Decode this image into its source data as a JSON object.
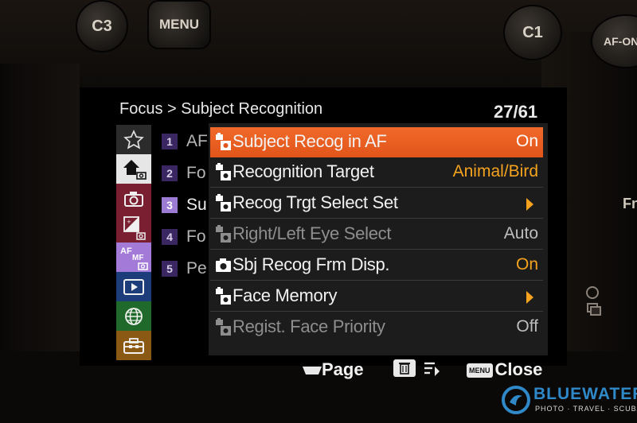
{
  "camera": {
    "buttons": {
      "c3": "C3",
      "menu": "MENU",
      "c1": "C1",
      "af_on": "AF-ON",
      "side_f": "Fn"
    }
  },
  "header": {
    "breadcrumb": "Focus > Subject Recognition",
    "page_counter": "27/61"
  },
  "tabs": [
    {
      "icon": "star-icon",
      "label": "My Menu"
    },
    {
      "icon": "home-camera-icon",
      "label": "Main"
    },
    {
      "icon": "camera-icon",
      "label": "Shooting"
    },
    {
      "icon": "exposure-icon",
      "label": "Exposure/Color"
    },
    {
      "icon": "af-mf-icon",
      "label": "Focus",
      "text": "AF MF"
    },
    {
      "icon": "playback-icon",
      "label": "Playback"
    },
    {
      "icon": "network-icon",
      "label": "Network"
    },
    {
      "icon": "toolbox-icon",
      "label": "Setup"
    }
  ],
  "pages": [
    {
      "num": "1",
      "label": "AF"
    },
    {
      "num": "2",
      "label": "Fo"
    },
    {
      "num": "3",
      "label": "Su"
    },
    {
      "num": "4",
      "label": "Fo"
    },
    {
      "num": "5",
      "label": "Pe"
    }
  ],
  "menu_items": [
    {
      "label": "Subject Recog in AF",
      "value": "On",
      "icon": "still-movie-icon"
    },
    {
      "label": "Recognition Target",
      "value": "Animal/Bird",
      "icon": "still-movie-icon"
    },
    {
      "label": "Recog Trgt Select Set",
      "value": "",
      "icon": "still-movie-icon",
      "arrow": true
    },
    {
      "label": "Right/Left Eye Select",
      "value": "Auto",
      "icon": "still-movie-icon"
    },
    {
      "label": "Sbj Recog Frm Disp.",
      "value": "On",
      "icon": "camera-icon"
    },
    {
      "label": "Face Memory",
      "value": "",
      "icon": "still-movie-icon",
      "arrow": true
    },
    {
      "label": "Regist. Face Priority",
      "value": "Off",
      "icon": "still-movie-icon"
    }
  ],
  "guide": {
    "page": "Page",
    "close": "Close",
    "menu_key": "MENU"
  },
  "watermark": {
    "title": "BLUEWATER",
    "subtitle": "PHOTO · TRAVEL · SCUBA"
  },
  "colors": {
    "accent_orange": "#e95e22",
    "value_orange": "#f5a31f",
    "tab_purple": "#9b7bd4",
    "panel_bg": "#1c1c1c",
    "logo_blue": "#2f88c8"
  }
}
